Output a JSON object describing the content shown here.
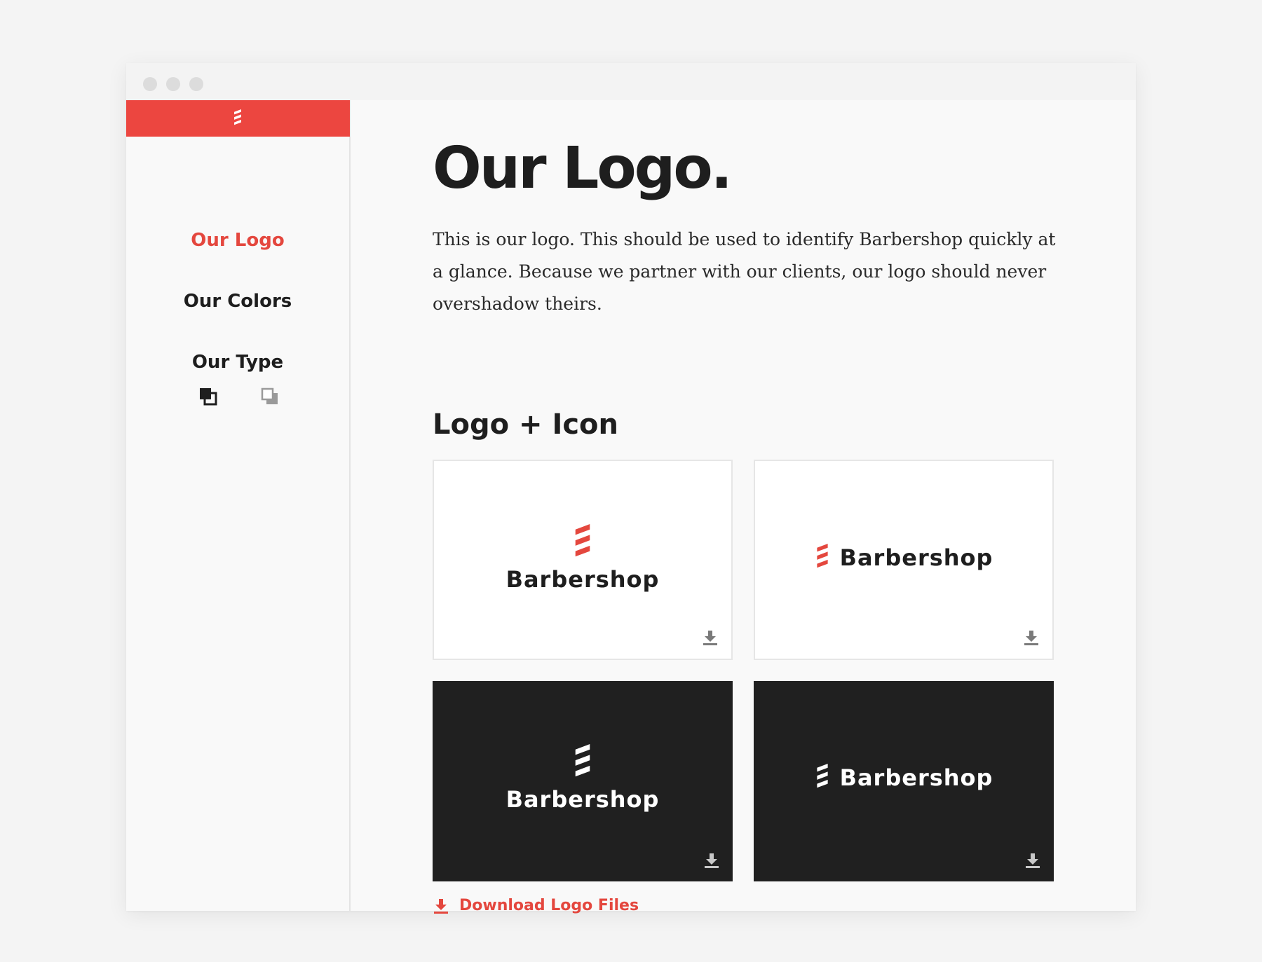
{
  "colors": {
    "brand_red": "#ec4640",
    "active_nav": "#e4473e",
    "text_dark": "#1e1e1e",
    "card_dark": "#202020"
  },
  "sidebar": {
    "brand_icon": "barbershop-pole-icon",
    "items": [
      {
        "label": "Our Logo",
        "active": true
      },
      {
        "label": "Our Colors",
        "active": false
      },
      {
        "label": "Our Type",
        "active": false
      }
    ],
    "theme_toggles": [
      "dark-theme-icon",
      "light-theme-icon"
    ]
  },
  "main": {
    "title": "Our Logo.",
    "intro": "This is our logo. This should be used to identify Barbershop quickly at a glance. Because we partner with our clients, our logo should never overshadow theirs.",
    "section_title": "Logo + Icon",
    "cards": [
      {
        "wordmark": "Barbershop",
        "variant": "stacked",
        "theme": "light"
      },
      {
        "wordmark": "Barbershop",
        "variant": "inline",
        "theme": "light"
      },
      {
        "wordmark": "Barbershop",
        "variant": "stacked",
        "theme": "dark"
      },
      {
        "wordmark": "Barbershop",
        "variant": "inline",
        "theme": "dark"
      }
    ],
    "download_label": "Download Logo Files",
    "download_icon": "download-icon"
  }
}
